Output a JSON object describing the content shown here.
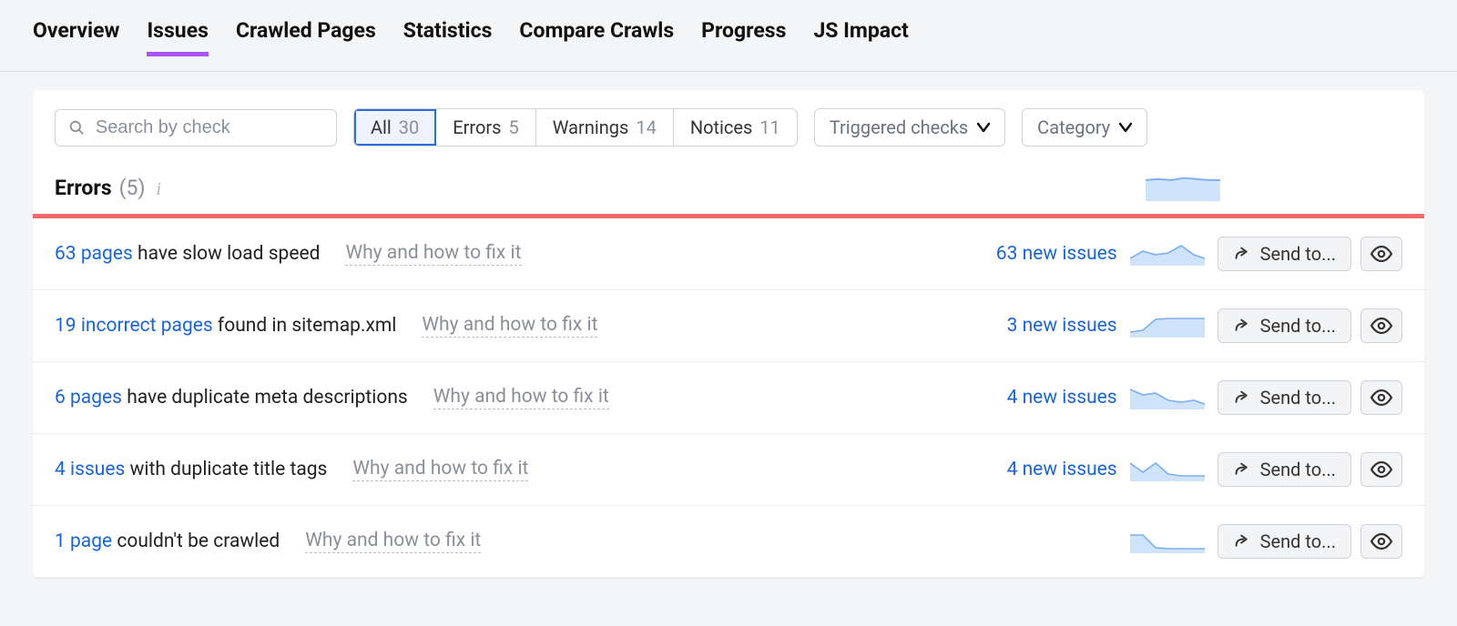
{
  "tabs": [
    {
      "label": "Overview"
    },
    {
      "label": "Issues",
      "active": true
    },
    {
      "label": "Crawled Pages"
    },
    {
      "label": "Statistics"
    },
    {
      "label": "Compare Crawls"
    },
    {
      "label": "Progress"
    },
    {
      "label": "JS Impact"
    }
  ],
  "search": {
    "placeholder": "Search by check"
  },
  "segments": {
    "all": {
      "label": "All",
      "count": "30",
      "active": true
    },
    "errors": {
      "label": "Errors",
      "count": "5"
    },
    "warnings": {
      "label": "Warnings",
      "count": "14"
    },
    "notices": {
      "label": "Notices",
      "count": "11"
    }
  },
  "dropdowns": {
    "triggered": {
      "label": "Triggered checks"
    },
    "category": {
      "label": "Category"
    }
  },
  "section": {
    "title": "Errors",
    "count": "(5)"
  },
  "hint_label": "Why and how to fix it",
  "send_label": "Send to...",
  "rows": [
    {
      "link": "63 pages",
      "rest": " have slow load speed",
      "new_issues": "63 new issues",
      "spark": "0,18 14,10 28,14 42,12 56,4 70,14 82,18"
    },
    {
      "link": "19 incorrect pages",
      "rest": " found in sitemap.xml",
      "new_issues": "3 new issues",
      "spark": "0,20 14,18 28,6 42,5 56,5 70,5 82,5"
    },
    {
      "link": "6 pages",
      "rest": " have duplicate meta descriptions",
      "new_issues": "4 new issues",
      "spark": "0,4 14,10 28,8 42,16 56,18 70,16 82,20"
    },
    {
      "link": "4 issues",
      "rest": " with duplicate title tags",
      "new_issues": "4 new issues",
      "spark": "0,6 14,16 28,6 42,18 56,20 70,20 82,20"
    },
    {
      "link": "1 page",
      "rest": " couldn't be crawled",
      "new_issues": "",
      "spark": "0,6 14,6 28,20 42,21 56,21 70,21 82,21"
    }
  ]
}
